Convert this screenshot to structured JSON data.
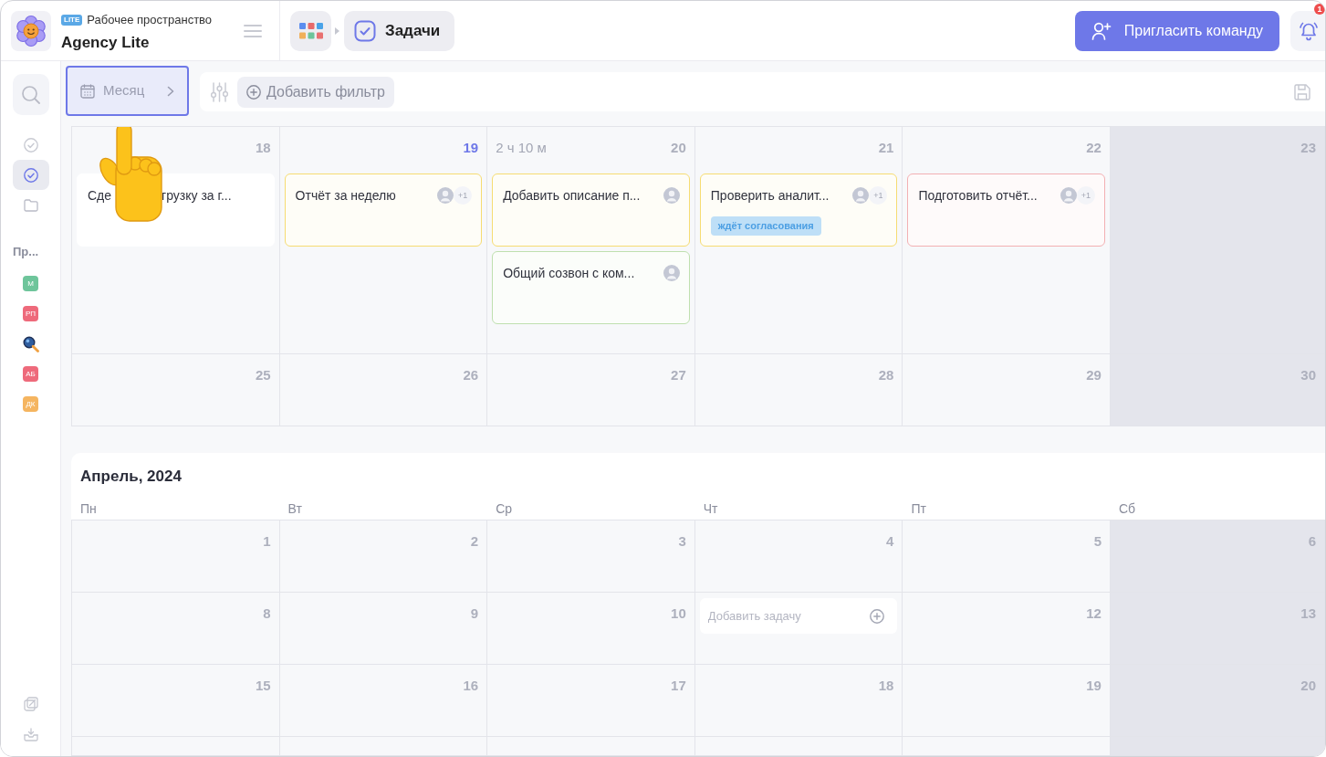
{
  "header": {
    "badge": "LITE",
    "workspace_label": "Рабочее пространство",
    "workspace_name": "Agency Lite",
    "current_page": "Задачи",
    "invite_button": "Пригласить команду",
    "notification_count": "1"
  },
  "sidebar": {
    "nav": [
      {
        "selected": false
      },
      {
        "selected": true
      },
      {
        "selected": false
      }
    ],
    "section_label": "Пр...",
    "projects": [
      {
        "kind": "initials",
        "label": "М",
        "color": "#6ec59b"
      },
      {
        "kind": "initials",
        "label": "РП",
        "color": "#ee6a7b"
      },
      {
        "kind": "image"
      },
      {
        "kind": "initials",
        "label": "АБ",
        "color": "#ee6a7b"
      },
      {
        "kind": "initials",
        "label": "ДК",
        "color": "#f5b560"
      }
    ]
  },
  "toolbar": {
    "view_mode": "Месяц",
    "add_filter": "Добавить фильтр"
  },
  "calendar": {
    "sections": [
      {
        "weeks": [
          {
            "days": [
              {
                "date": "18",
                "today": false,
                "weekend": false,
                "tasks": [
                  {
                    "title_parts": [
                      "Сде",
                      "грузку за г..."
                    ],
                    "color": "#ffffff",
                    "avatar": false
                  }
                ]
              },
              {
                "date": "19",
                "today": true,
                "weekend": false,
                "tasks": [
                  {
                    "title": "Отчёт за неделю",
                    "color": "#f6dc72",
                    "avatar": true,
                    "extra_assignees": "+1"
                  }
                ]
              },
              {
                "date": "20",
                "today": false,
                "weekend": false,
                "duration": "2 ч 10 м",
                "tasks": [
                  {
                    "title": "Добавить описание п...",
                    "color": "#f6dc72",
                    "avatar": true
                  },
                  {
                    "title": "Общий созвон с ком...",
                    "color": "#bfe0af",
                    "avatar": true
                  }
                ]
              },
              {
                "date": "21",
                "today": false,
                "weekend": false,
                "tasks": [
                  {
                    "title": "Проверить аналит...",
                    "color": "#f6dc72",
                    "avatar": true,
                    "extra_assignees": "+1",
                    "tag": "ждёт согласования"
                  }
                ]
              },
              {
                "date": "22",
                "today": false,
                "weekend": false,
                "tasks": [
                  {
                    "title": "Подготовить отчёт...",
                    "color": "#f3b0b3",
                    "avatar": true,
                    "extra_assignees": "+1"
                  }
                ]
              },
              {
                "date": "23",
                "today": false,
                "weekend": true
              }
            ]
          },
          {
            "days": [
              {
                "date": "25",
                "today": false,
                "weekend": false
              },
              {
                "date": "26",
                "today": false,
                "weekend": false
              },
              {
                "date": "27",
                "today": false,
                "weekend": false
              },
              {
                "date": "28",
                "today": false,
                "weekend": false
              },
              {
                "date": "29",
                "today": false,
                "weekend": false
              },
              {
                "date": "30",
                "today": false,
                "weekend": true
              }
            ]
          }
        ]
      },
      {
        "title": "Апрель, 2024",
        "weekdays": [
          "Пн",
          "Вт",
          "Ср",
          "Чт",
          "Пт",
          "Сб"
        ],
        "weeks": [
          {
            "days": [
              {
                "date": "1",
                "today": false,
                "weekend": false
              },
              {
                "date": "2",
                "today": false,
                "weekend": false
              },
              {
                "date": "3",
                "today": false,
                "weekend": false
              },
              {
                "date": "4",
                "today": false,
                "weekend": false
              },
              {
                "date": "5",
                "today": false,
                "weekend": false
              },
              {
                "date": "6",
                "today": false,
                "weekend": true
              }
            ]
          },
          {
            "days": [
              {
                "date": "8",
                "today": false,
                "weekend": false
              },
              {
                "date": "9",
                "today": false,
                "weekend": false
              },
              {
                "date": "10",
                "today": false,
                "weekend": false
              },
              {
                "weekend": false,
                "add_task_placeholder": "Добавить задачу"
              },
              {
                "date": "12",
                "today": false,
                "weekend": false
              },
              {
                "date": "13",
                "today": false,
                "weekend": true
              }
            ]
          },
          {
            "days": [
              {
                "date": "15",
                "today": false,
                "weekend": false
              },
              {
                "date": "16",
                "today": false,
                "weekend": false
              },
              {
                "date": "17",
                "today": false,
                "weekend": false
              },
              {
                "date": "18",
                "today": false,
                "weekend": false
              },
              {
                "date": "19",
                "today": false,
                "weekend": false
              },
              {
                "date": "20",
                "today": false,
                "weekend": true
              }
            ]
          },
          {
            "days": [
              {
                "weekend": false
              },
              {
                "weekend": false
              },
              {
                "weekend": false
              },
              {
                "weekend": false
              },
              {
                "weekend": false
              },
              {
                "weekend": true
              }
            ]
          }
        ]
      }
    ]
  }
}
